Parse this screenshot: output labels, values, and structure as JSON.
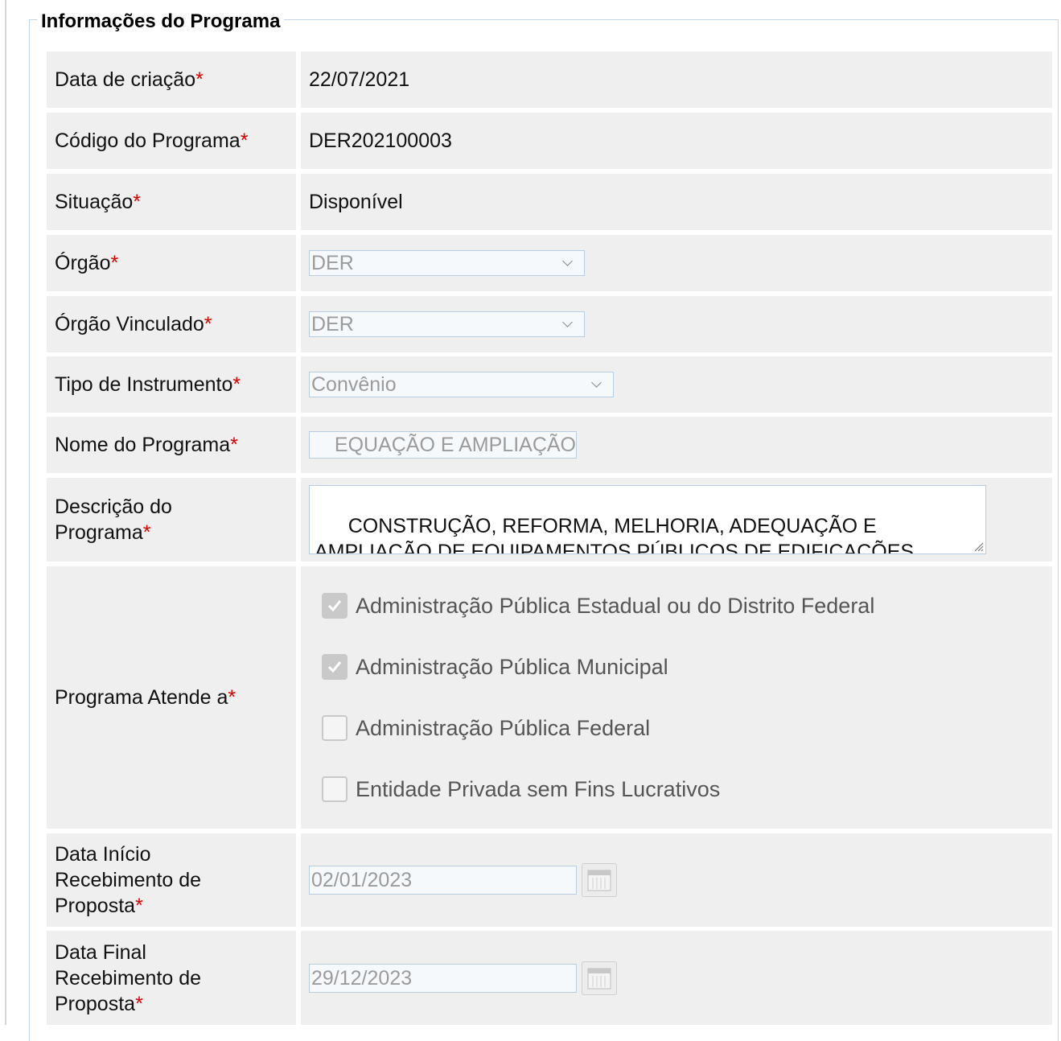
{
  "form": {
    "legend": "Informações do Programa",
    "required_mark": "*",
    "fields": {
      "data_criacao": {
        "label": "Data de criação",
        "value": "22/07/2021"
      },
      "codigo": {
        "label": "Código do Programa",
        "value": "DER202100003"
      },
      "situacao": {
        "label": "Situação",
        "value": "Disponível"
      },
      "orgao": {
        "label": "Órgão",
        "value": "DER"
      },
      "orgao_vinculado": {
        "label": "Órgão Vinculado",
        "value": "DER"
      },
      "tipo_instrumento": {
        "label": "Tipo de Instrumento",
        "value": "Convênio"
      },
      "nome_programa": {
        "label": "Nome do Programa",
        "value": "EQUAÇÃO E AMPLIAÇÃO"
      },
      "descricao": {
        "label_line1": "Descrição do",
        "label_line2": "Programa",
        "value": "CONSTRUÇÃO, REFORMA, MELHORIA, ADEQUAÇÃO E\nAMPLIAÇÃO DE EQUIPAMENTOS PÚBLICOS DE EDIFICAÇÕES,"
      },
      "atende": {
        "label": "Programa Atende a",
        "options": [
          {
            "label": "Administração Pública Estadual ou do Distrito Federal",
            "checked": true
          },
          {
            "label": "Administração Pública Municipal",
            "checked": true
          },
          {
            "label": "Administração Pública Federal",
            "checked": false
          },
          {
            "label": "Entidade Privada sem Fins Lucrativos",
            "checked": false
          }
        ]
      },
      "data_inicio": {
        "label_line1": "Data Início",
        "label_line2": "Recebimento de",
        "label_line3": "Proposta",
        "value": "02/01/2023"
      },
      "data_final": {
        "label_line1": "Data Final",
        "label_line2": "Recebimento de",
        "label_line3": "Proposta",
        "value": "29/12/2023"
      }
    }
  },
  "icons": [
    "check-icon",
    "chevron-down-icon",
    "calendar-icon",
    "resize-grip-icon"
  ]
}
